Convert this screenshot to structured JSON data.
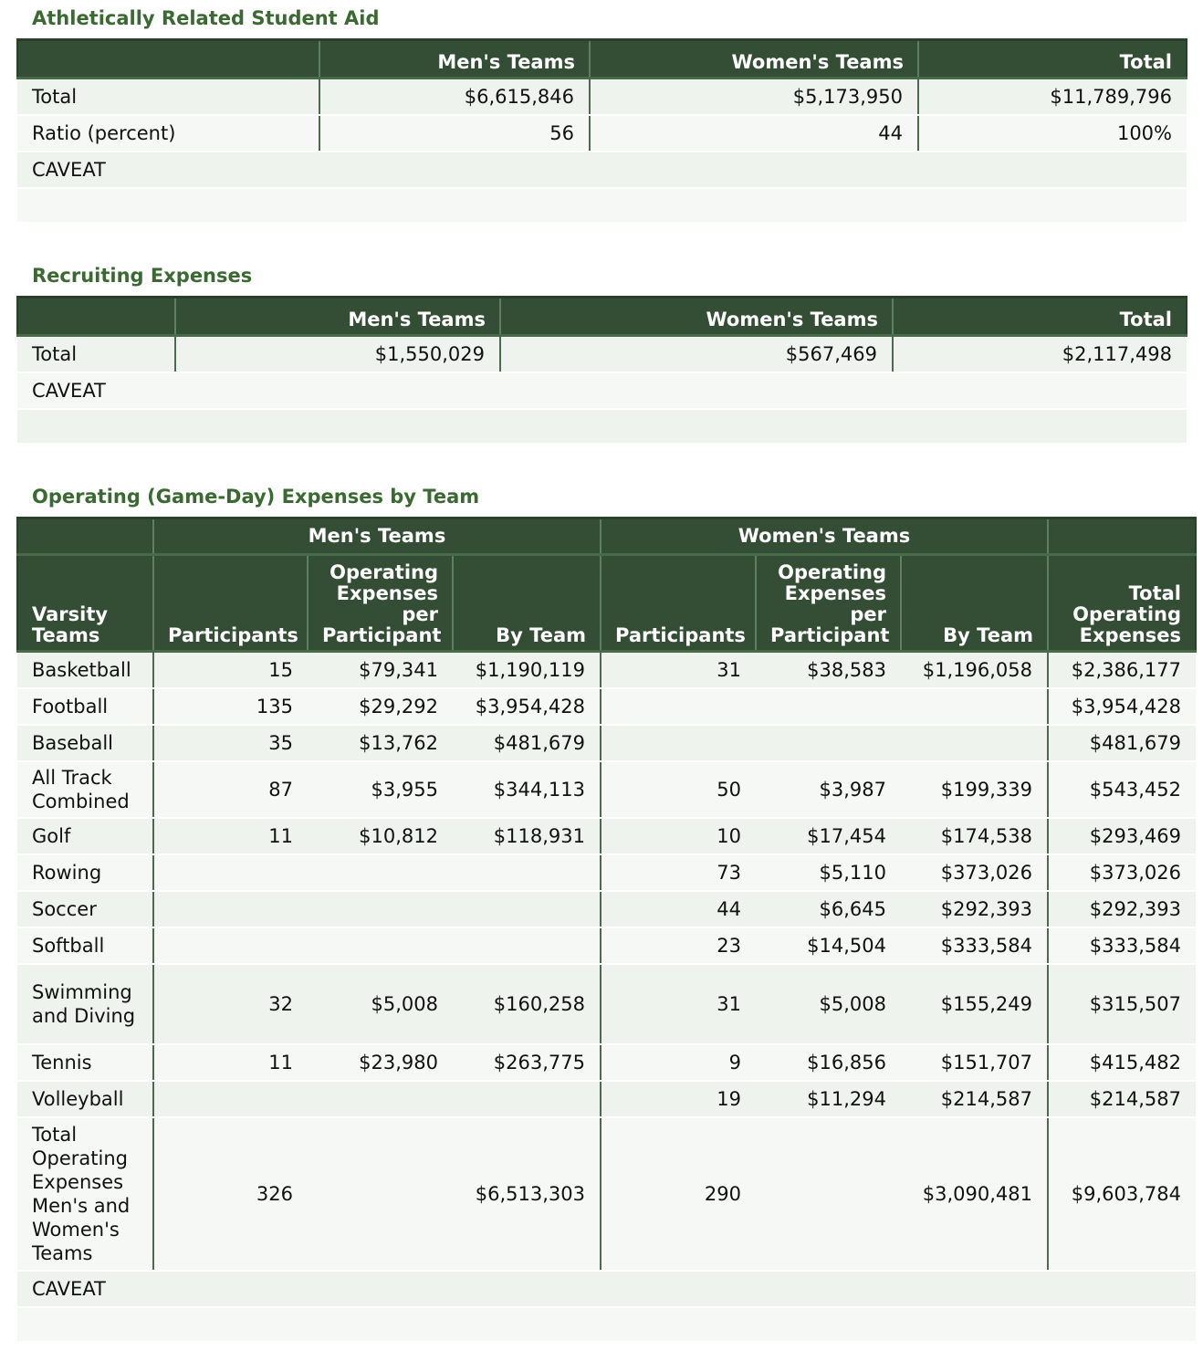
{
  "aid": {
    "title": "Athletically Related Student Aid",
    "headers": [
      "",
      "Men's Teams",
      "Women's Teams",
      "Total"
    ],
    "rows": [
      [
        "Total",
        "$6,615,846",
        "$5,173,950",
        "$11,789,796"
      ],
      [
        "Ratio (percent)",
        "56",
        "44",
        "100%"
      ]
    ],
    "caveat": "CAVEAT"
  },
  "recruiting": {
    "title": "Recruiting Expenses",
    "headers": [
      "",
      "Men's Teams",
      "Women's Teams",
      "Total"
    ],
    "rows": [
      [
        "Total",
        "$1,550,029",
        "$567,469",
        "$2,117,498"
      ]
    ],
    "caveat": "CAVEAT"
  },
  "operating": {
    "title": "Operating (Game-Day) Expenses by Team",
    "group_headers": [
      "",
      "Men's Teams",
      "Women's Teams",
      ""
    ],
    "headers": [
      "Varsity Teams",
      "Participants",
      "Operating Expenses per Participant",
      "By Team",
      "Participants",
      "Operating Expenses per Participant",
      "By Team",
      "Total Operating Expenses"
    ],
    "rows": [
      [
        "Basketball",
        "15",
        "$79,341",
        "$1,190,119",
        "31",
        "$38,583",
        "$1,196,058",
        "$2,386,177"
      ],
      [
        "Football",
        "135",
        "$29,292",
        "$3,954,428",
        "",
        "",
        "",
        "$3,954,428"
      ],
      [
        "Baseball",
        "35",
        "$13,762",
        "$481,679",
        "",
        "",
        "",
        "$481,679"
      ],
      [
        "All Track Combined",
        "87",
        "$3,955",
        "$344,113",
        "50",
        "$3,987",
        "$199,339",
        "$543,452"
      ],
      [
        "Golf",
        "11",
        "$10,812",
        "$118,931",
        "10",
        "$17,454",
        "$174,538",
        "$293,469"
      ],
      [
        "Rowing",
        "",
        "",
        "",
        "73",
        "$5,110",
        "$373,026",
        "$373,026"
      ],
      [
        "Soccer",
        "",
        "",
        "",
        "44",
        "$6,645",
        "$292,393",
        "$292,393"
      ],
      [
        "Softball",
        "",
        "",
        "",
        "23",
        "$14,504",
        "$333,584",
        "$333,584"
      ],
      [
        "Swimming and Diving",
        "32",
        "$5,008",
        "$160,258",
        "31",
        "$5,008",
        "$155,249",
        "$315,507"
      ],
      [
        "Tennis",
        "11",
        "$23,980",
        "$263,775",
        "9",
        "$16,856",
        "$151,707",
        "$415,482"
      ],
      [
        "Volleyball",
        "",
        "",
        "",
        "19",
        "$11,294",
        "$214,587",
        "$214,587"
      ],
      [
        "Total Operating Expenses Men's and Women's Teams",
        "326",
        "",
        "$6,513,303",
        "290",
        "",
        "$3,090,481",
        "$9,603,784"
      ]
    ],
    "caveat": "CAVEAT"
  }
}
